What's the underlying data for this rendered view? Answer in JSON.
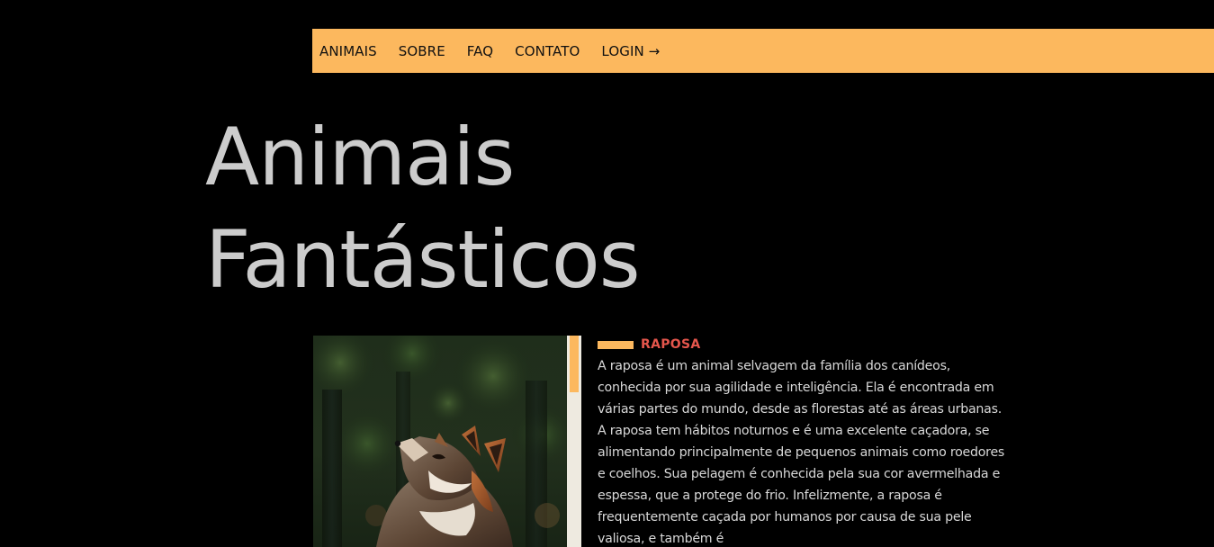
{
  "nav": {
    "items": [
      "ANIMAIS",
      "SOBRE",
      "FAQ",
      "CONTATO",
      "LOGIN →"
    ]
  },
  "hero": {
    "title_line1": "Animais",
    "title_line2": "Fantásticos"
  },
  "animal": {
    "name": "RAPOSA",
    "photo_alt": "raposa",
    "description": "A raposa é um animal selvagem da família dos canídeos, conhecida por sua agilidade e inteligência. Ela é encontrada em várias partes do mundo, desde as florestas até as áreas urbanas. A raposa tem hábitos noturnos e é uma excelente caçadora, se alimentando principalmente de pequenos animais como roedores e coelhos. Sua pelagem é conhecida pela sua cor avermelhada e espessa, que a protege do frio. Infelizmente, a raposa é frequentemente caçada por humanos por causa de sua pele valiosa, e também é"
  },
  "colors": {
    "background": "#000000",
    "accent": "#FCB85E",
    "title": "#CCCCCC",
    "animal_name": "#E5564C",
    "body_text": "#D8D8D8",
    "scroll_track": "#EEEAE0"
  },
  "icons": {
    "login_arrow": "arrow-right-icon"
  }
}
